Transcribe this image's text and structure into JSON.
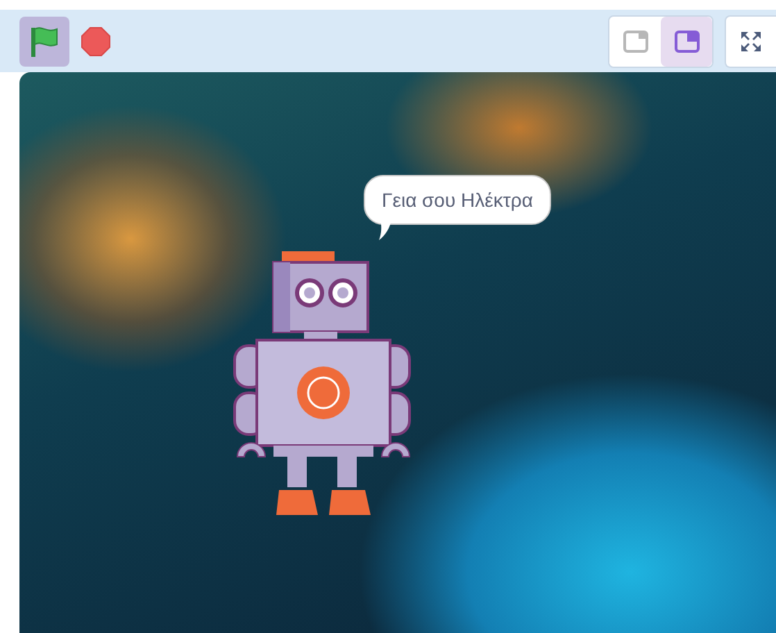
{
  "toolbar": {
    "green_flag": {
      "active": true
    },
    "stop": {
      "active": false
    },
    "layout_modes": [
      {
        "kind": "small",
        "selected": false
      },
      {
        "kind": "normal",
        "selected": true
      }
    ],
    "fullscreen": {
      "kind": "fullscreen"
    }
  },
  "stage": {
    "speech_bubble": {
      "text": "Γεια σου Ηλέκτρα"
    }
  }
}
